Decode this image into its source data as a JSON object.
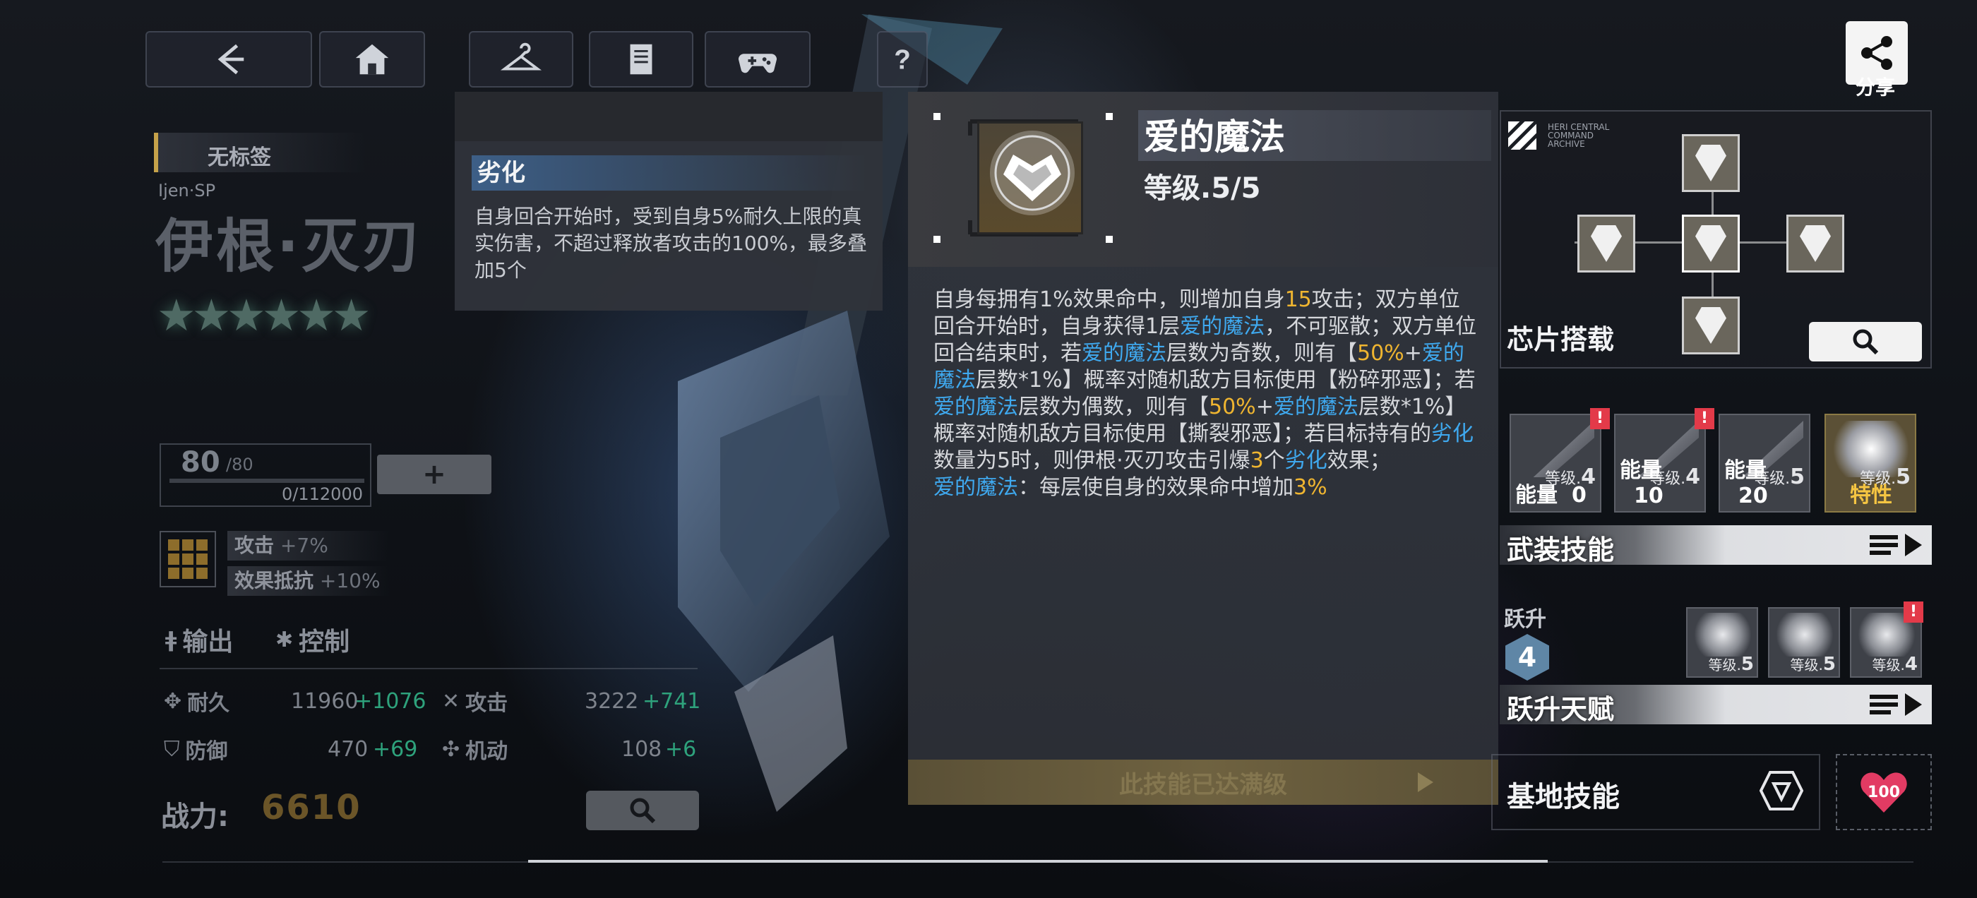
{
  "nav": {
    "back_icon": "back-arrow-icon",
    "home_icon": "home-icon",
    "wardrobe_icon": "hanger-icon",
    "archive_icon": "book-icon",
    "game_icon": "gamepad-icon",
    "help_icon": "question-icon"
  },
  "share": {
    "label": "分享"
  },
  "character": {
    "tag": "无标签",
    "code": "Ijen·SP",
    "name": "伊根·灭刃",
    "stars": "★★★★★★",
    "level": "80",
    "level_max": "/80",
    "exp": "0/112000",
    "plus": "+",
    "bonus_1_label": "攻击",
    "bonus_1_value": "+7%",
    "bonus_2_label": "效果抵抗",
    "bonus_2_value": "+10%",
    "role_1": "输出",
    "role_2": "控制",
    "stats": {
      "hp_label": "耐久",
      "hp_value": "11960",
      "hp_add": "+1076",
      "atk_label": "攻击",
      "atk_value": "3222",
      "atk_add": "+741",
      "def_label": "防御",
      "def_value": "470",
      "def_add": "+69",
      "mob_label": "机动",
      "mob_value": "108",
      "mob_add": "+6"
    },
    "power_label": "战力:",
    "power_value": "6610"
  },
  "tooltip": {
    "title": "劣化",
    "text": "自身回合开始时，受到自身5%耐久上限的真实伤害，不超过释放者攻击的100%，最多叠加5个"
  },
  "skill": {
    "name": "爱的魔法",
    "level": "等级.5/5",
    "desc": [
      {
        "t": "自身每拥有1%效果命中，则增加自身",
        "c": ""
      },
      {
        "t": "15",
        "c": "y"
      },
      {
        "t": "攻击；双方单位回合开始时，自身获得1层",
        "c": ""
      },
      {
        "t": "爱的魔法",
        "c": "b"
      },
      {
        "t": "，不可驱散；双方单位回合结束时，若",
        "c": ""
      },
      {
        "t": "爱的魔法",
        "c": "b"
      },
      {
        "t": "层数为奇数，则有【",
        "c": ""
      },
      {
        "t": "50%",
        "c": "y"
      },
      {
        "t": "+",
        "c": ""
      },
      {
        "t": "爱的魔法",
        "c": "b"
      },
      {
        "t": "层数*1%】概率对随机敌方目标使用【粉碎邪恶】；若",
        "c": ""
      },
      {
        "t": "爱的魔法",
        "c": "b"
      },
      {
        "t": "层数为偶数，则有【",
        "c": ""
      },
      {
        "t": "50%",
        "c": "y"
      },
      {
        "t": "+",
        "c": ""
      },
      {
        "t": "爱的魔法",
        "c": "b"
      },
      {
        "t": "层数*1%】概率对随机敌方目标使用【撕裂邪恶】；若目标持有的",
        "c": ""
      },
      {
        "t": "劣化",
        "c": "b"
      },
      {
        "t": "数量为5时，则伊根·灭刃攻击引爆",
        "c": ""
      },
      {
        "t": "3",
        "c": "y"
      },
      {
        "t": "个",
        "c": ""
      },
      {
        "t": "劣化",
        "c": "b"
      },
      {
        "t": "效果；",
        "c": ""
      },
      {
        "t": "\n",
        "c": ""
      },
      {
        "t": "爱的魔法",
        "c": "b"
      },
      {
        "t": "：每层使自身的效果命中增加",
        "c": ""
      },
      {
        "t": "3%",
        "c": "y"
      }
    ],
    "max_button": "此技能已达满级"
  },
  "chips": {
    "label": "芯片搭载",
    "archive_text": "HERI CENTRAL COMMAND ARCHIVE"
  },
  "skills_row": [
    {
      "lv_prefix": "等级.",
      "lv": "4",
      "energy_label": "能量",
      "energy": "0",
      "badge": "!"
    },
    {
      "lv_prefix": "等级.",
      "lv": "4",
      "energy_label": "能量",
      "energy": "10",
      "badge": "!"
    },
    {
      "lv_prefix": "等级.",
      "lv": "5",
      "energy_label": "能量",
      "energy": "20",
      "badge": ""
    },
    {
      "lv_prefix": "等级.",
      "lv": "5",
      "energy_label": "特性",
      "energy": "",
      "badge": ""
    }
  ],
  "armed_skills": {
    "label": "武装技能"
  },
  "ascension": {
    "label": "跃升",
    "level": "4",
    "cards": [
      {
        "lv_prefix": "等级.",
        "lv": "5"
      },
      {
        "lv_prefix": "等级.",
        "lv": "5"
      },
      {
        "lv_prefix": "等级.",
        "lv": "4",
        "badge": "!"
      }
    ],
    "talent_label": "跃升天赋"
  },
  "base": {
    "label": "基地技能",
    "heart_value": "100"
  }
}
